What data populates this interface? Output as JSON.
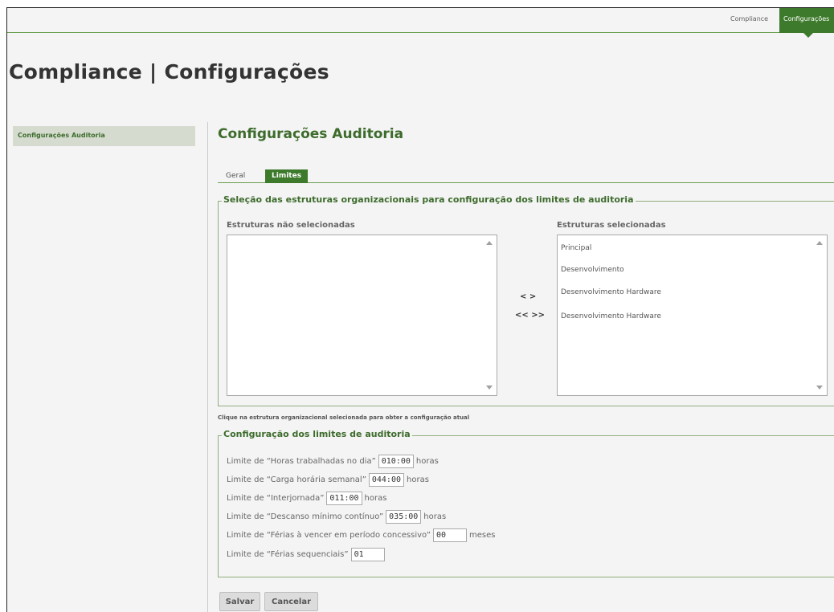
{
  "topnav": {
    "compliance_label": "Compliance",
    "configuracoes_label": "Configurações"
  },
  "page_title": "Compliance | Configurações",
  "sidebar": {
    "items": [
      {
        "label": "Configurações Auditoria"
      }
    ]
  },
  "section_title": "Configurações Auditoria",
  "tabs": [
    {
      "label": "Geral",
      "active": false
    },
    {
      "label": "Limites",
      "active": true
    }
  ],
  "selection_box": {
    "legend": "Seleção das estruturas organizacionais para configuração dos limites de auditoria",
    "unselected_label": "Estruturas não selecionadas",
    "unselected_items": [],
    "selected_label": "Estruturas selecionadas",
    "selected_items": [
      "Principal",
      "Desenvolvimento",
      "Desenvolvimento Hardware",
      "Desenvolvimento Hardware"
    ],
    "move_one_label": "< >",
    "move_all_label": "<< >>"
  },
  "hint": "Clique na estrutura organizacional selecionada para obter a configuração atual",
  "limits_box": {
    "legend": "Configuração dos limites de auditoria",
    "rows": [
      {
        "label": "Limite de “Horas trabalhadas no dia”",
        "value": "010:00",
        "unit": "horas"
      },
      {
        "label": "Limite de “Carga horária semanal”",
        "value": "044:00",
        "unit": "horas"
      },
      {
        "label": "Limite de “Interjornada”",
        "value": "011:00",
        "unit": "horas"
      },
      {
        "label": "Limite de “Descanso mínimo contínuo”",
        "value": "035:00",
        "unit": "horas"
      },
      {
        "label": "Limite de “Férias à vencer em período concessivo”",
        "value": "00",
        "unit": "meses"
      },
      {
        "label": "Limite de “Férias sequenciais”",
        "value": "01",
        "unit": ""
      }
    ]
  },
  "buttons": {
    "save_label": "Salvar",
    "cancel_label": "Cancelar"
  },
  "colors": {
    "accent": "#3d7a2b",
    "heading_green": "#3d6b2c",
    "background": "#f4f4f4"
  }
}
